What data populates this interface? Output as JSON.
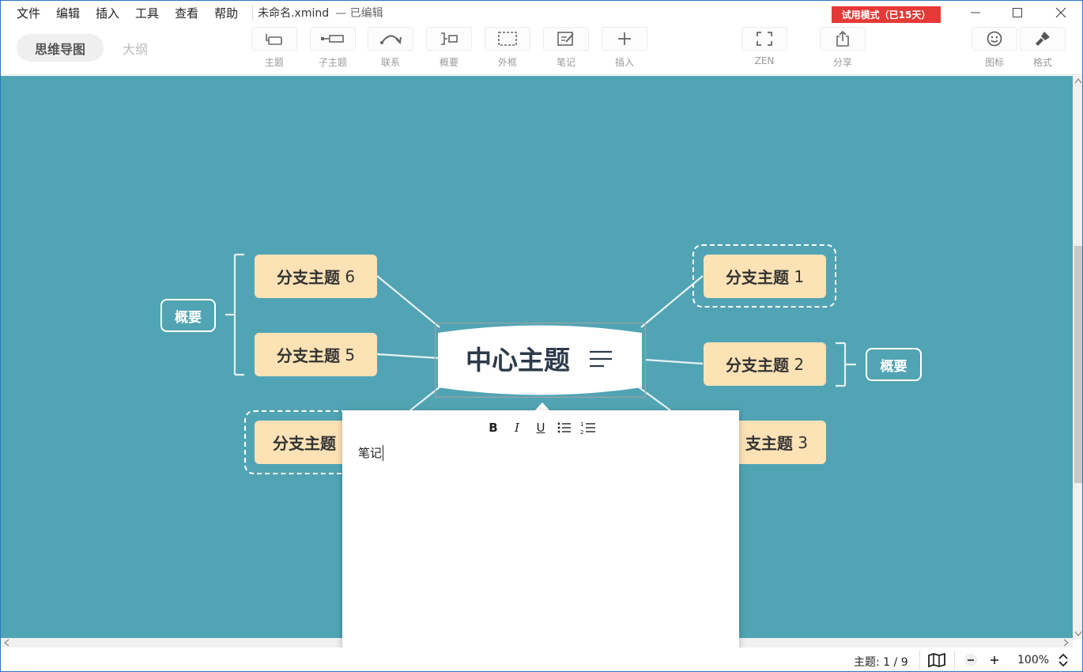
{
  "menu": [
    "文件",
    "编辑",
    "插入",
    "工具",
    "查看",
    "帮助"
  ],
  "document": {
    "title": "未命名.xmind",
    "status": "— 已编辑"
  },
  "trial_badge": "试用模式（已15天）",
  "view_tabs": {
    "mindmap": "思维导图",
    "outline": "大纲"
  },
  "toolbar": {
    "topic": "主题",
    "subtopic": "子主题",
    "relationship": "联系",
    "summary": "概要",
    "boundary": "外框",
    "note": "笔记",
    "insert": "插入",
    "zen": "ZEN",
    "share": "分享",
    "icon": "图标",
    "format": "格式"
  },
  "mindmap": {
    "central_topic": "中心主题",
    "branch_prefix": "分支主题",
    "branches": [
      {
        "id": 1,
        "num": "1"
      },
      {
        "id": 2,
        "num": "2"
      },
      {
        "id": 3,
        "num": "3"
      },
      {
        "id": 4,
        "num": ""
      },
      {
        "id": 5,
        "num": "5"
      },
      {
        "id": 6,
        "num": "6"
      }
    ],
    "summary_left": "概要",
    "summary_right": "概要",
    "branch3_visible": "支主题",
    "branch4_visible": "分支主题"
  },
  "note_editor": {
    "format_buttons": [
      "B",
      "I",
      "U"
    ],
    "text": "笔记"
  },
  "statusbar": {
    "topic_count": "主题: 1 / 9",
    "zoom": "100%"
  },
  "colors": {
    "canvas": "#51a4b4",
    "branch_fill": "#fde2b6",
    "trial_badge": "#e53935",
    "central_text": "#2d3a4a"
  }
}
